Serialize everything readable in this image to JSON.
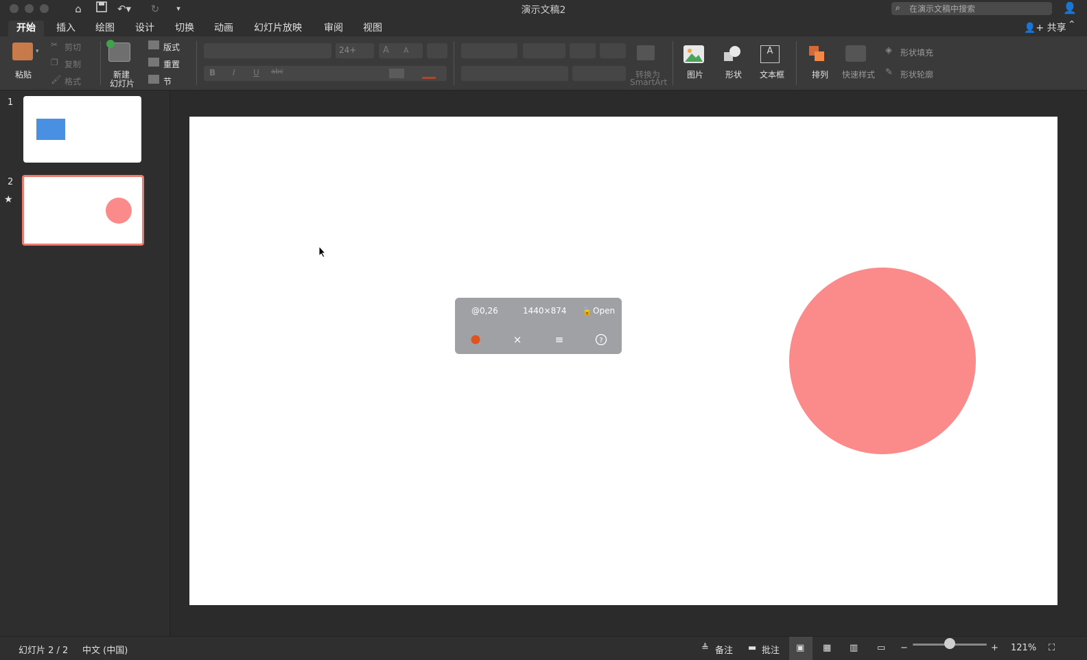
{
  "window": {
    "title": "演示文稿2"
  },
  "search": {
    "placeholder": "在演示文稿中搜索"
  },
  "tabs": [
    {
      "label": "开始",
      "active": true
    },
    {
      "label": "插入"
    },
    {
      "label": "绘图"
    },
    {
      "label": "设计"
    },
    {
      "label": "切换"
    },
    {
      "label": "动画"
    },
    {
      "label": "幻灯片放映"
    },
    {
      "label": "审阅"
    },
    {
      "label": "视图"
    }
  ],
  "share": {
    "label": "共享"
  },
  "ribbon": {
    "paste": "粘贴",
    "cut": "剪切",
    "copy": "复制",
    "format": "格式",
    "new_slide_1": "新建",
    "new_slide_2": "幻灯片",
    "layout": "版式",
    "reset": "重置",
    "section": "节",
    "font_size": "24+",
    "bold": "B",
    "italic": "I",
    "underline": "U",
    "strike": "abc",
    "grow": "A",
    "shrink": "A",
    "convert_1": "转换为",
    "convert_2": "SmartArt",
    "picture": "图片",
    "shape": "形状",
    "textbox": "文本框",
    "arrange": "排列",
    "quick_styles": "快速样式",
    "shape_fill": "形状填充",
    "shape_outline": "形状轮廓"
  },
  "slides": [
    {
      "number": "1",
      "shape": "rectangle",
      "color": "#4a90e2"
    },
    {
      "number": "2",
      "shape": "circle",
      "color": "#fb8a8a",
      "selected": true
    }
  ],
  "overlay": {
    "position": "@0,26",
    "size": "1440×874",
    "lock_state": "Open"
  },
  "status": {
    "slide_counter": "幻灯片 2 / 2",
    "language": "中文 (中国)",
    "notes": "备注",
    "comments": "批注",
    "zoom": "121%",
    "zoom_fraction": 0.5
  },
  "colors": {
    "accent_circle": "#fb8a8a",
    "thumb_rect": "#4a90e2",
    "record_dot": "#e0531c",
    "selection": "#f07a6e"
  }
}
